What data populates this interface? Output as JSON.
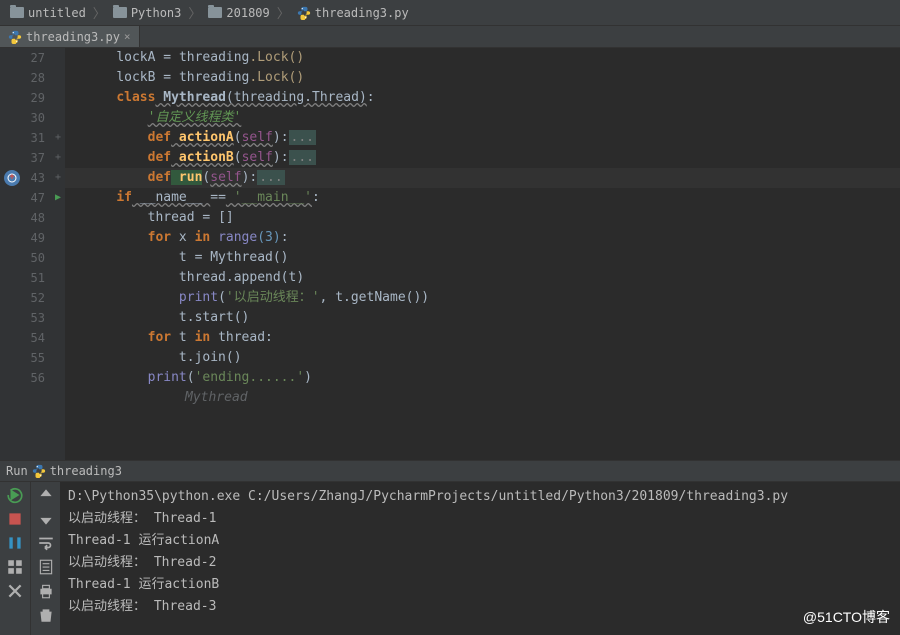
{
  "breadcrumb": {
    "items": [
      {
        "icon": "folder",
        "label": "untitled"
      },
      {
        "icon": "folder",
        "label": "Python3"
      },
      {
        "icon": "folder",
        "label": "201809"
      },
      {
        "icon": "python",
        "label": "threading3.py"
      }
    ]
  },
  "tab": {
    "icon": "python",
    "label": "threading3.py"
  },
  "gutter": {
    "lines": [
      "27",
      "28",
      "29",
      "30",
      "31",
      "37",
      "43",
      "47",
      "48",
      "49",
      "50",
      "51",
      "52",
      "53",
      "54",
      "55",
      "56"
    ]
  },
  "code": {
    "l27": {
      "indent": "    ",
      "var": "lockA",
      "eq": " = ",
      "mod": "threading",
      "call": ".Lock()"
    },
    "l28": {
      "indent": "    ",
      "var": "lockB",
      "eq": " = ",
      "mod": "threading",
      "call": ".Lock()"
    },
    "l29": {
      "indent": "    ",
      "kw": "class",
      "name": " Mythread",
      "args": "(threading.Thread)",
      "colon": ":"
    },
    "l30": {
      "indent": "        ",
      "doc": "'自定义线程类'"
    },
    "l31": {
      "indent": "        ",
      "kw": "def",
      "name": " actionA",
      "args": "(",
      "self": "self",
      "close": "):",
      "fold": "..."
    },
    "l37": {
      "indent": "        ",
      "kw": "def",
      "name": " actionB",
      "args": "(",
      "self": "self",
      "close": "):",
      "fold": "..."
    },
    "l43": {
      "indent": "        ",
      "kw": "def",
      "name": " run",
      "args": "(",
      "self": "self",
      "close": "):",
      "fold": "..."
    },
    "l47": {
      "indent": "    ",
      "kw": "if",
      "name": " __name__ ",
      "eq": "==",
      "str": " '__main__'",
      "colon": ":"
    },
    "l48": {
      "indent": "        ",
      "var": "thread = []"
    },
    "l49": {
      "indent": "        ",
      "kw": "for",
      "x": " x ",
      "kw2": "in",
      "call": " range",
      "num": "(3)",
      "colon": ":"
    },
    "l50": {
      "indent": "            ",
      "txt": "t = Mythread()"
    },
    "l51": {
      "indent": "            ",
      "txt": "thread.append(t)"
    },
    "l52": {
      "indent": "            ",
      "fn": "print",
      "open": "(",
      "str": "'以启动线程：'",
      "comma": ", t.getName())"
    },
    "l53": {
      "indent": "            ",
      "txt": "t.start()"
    },
    "l54": {
      "indent": "        ",
      "kw": "for",
      "x": " t ",
      "kw2": "in",
      "var": " thread",
      "colon": ":"
    },
    "l55": {
      "indent": "            ",
      "txt": "t.join()"
    },
    "l56": {
      "indent": "        ",
      "fn": "print",
      "open": "(",
      "str": "'ending......'",
      "close": ")"
    }
  },
  "hint": "Mythread",
  "run_header": {
    "label": "Run",
    "config": "threading3"
  },
  "console": {
    "lines": [
      "D:\\Python35\\python.exe C:/Users/ZhangJ/PycharmProjects/untitled/Python3/201809/threading3.py",
      "以启动线程： Thread-1",
      "Thread-1 运行actionA",
      "以启动线程： Thread-2",
      "Thread-1 运行actionB",
      "以启动线程： Thread-3"
    ]
  },
  "watermark": "@51CTO博客"
}
